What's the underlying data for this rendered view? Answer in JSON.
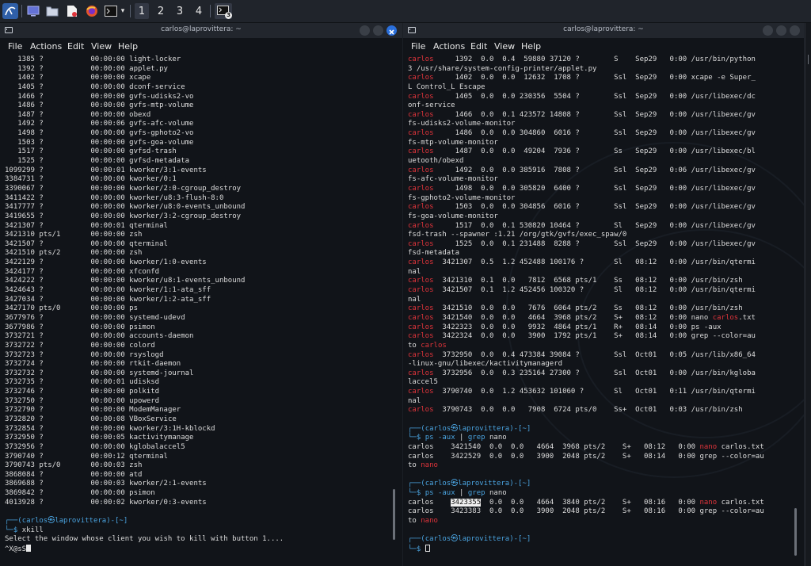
{
  "taskbar": {
    "workspaces": [
      "1",
      "2",
      "3",
      "4"
    ],
    "badge": "3"
  },
  "window_left": {
    "title": "carlos@laprovittera: ~",
    "menu": [
      "File",
      "Actions",
      "Edit",
      "View",
      "Help"
    ],
    "rows": [
      [
        "1385",
        "?",
        "00:00:00",
        "light-locker"
      ],
      [
        "1392",
        "?",
        "00:00:00",
        "applet.py"
      ],
      [
        "1402",
        "?",
        "00:00:00",
        "xcape"
      ],
      [
        "1405",
        "?",
        "00:00:00",
        "dconf-service"
      ],
      [
        "1466",
        "?",
        "00:00:00",
        "gvfs-udisks2-vo"
      ],
      [
        "1486",
        "?",
        "00:00:00",
        "gvfs-mtp-volume"
      ],
      [
        "1487",
        "?",
        "00:00:00",
        "obexd"
      ],
      [
        "1492",
        "?",
        "00:00:06",
        "gvfs-afc-volume"
      ],
      [
        "1498",
        "?",
        "00:00:00",
        "gvfs-gphoto2-vo"
      ],
      [
        "1503",
        "?",
        "00:00:00",
        "gvfs-goa-volume"
      ],
      [
        "1517",
        "?",
        "00:00:00",
        "gvfsd-trash"
      ],
      [
        "1525",
        "?",
        "00:00:00",
        "gvfsd-metadata"
      ],
      [
        "1099299",
        "?",
        "00:00:01",
        "kworker/3:1-events"
      ],
      [
        "3384731",
        "?",
        "00:00:00",
        "kworker/0:1"
      ],
      [
        "3390067",
        "?",
        "00:00:00",
        "kworker/2:0-cgroup_destroy"
      ],
      [
        "3411422",
        "?",
        "00:00:00",
        "kworker/u8:3-flush-8:0"
      ],
      [
        "3417777",
        "?",
        "00:00:00",
        "kworker/u8:0-events_unbound"
      ],
      [
        "3419655",
        "?",
        "00:00:00",
        "kworker/3:2-cgroup_destroy"
      ],
      [
        "3421307",
        "?",
        "00:00:01",
        "qterminal"
      ],
      [
        "3421310",
        "pts/1",
        "00:00:00",
        "zsh"
      ],
      [
        "3421507",
        "?",
        "00:00:00",
        "qterminal"
      ],
      [
        "3421510",
        "pts/2",
        "00:00:00",
        "zsh"
      ],
      [
        "3422129",
        "?",
        "00:00:00",
        "kworker/1:0-events"
      ],
      [
        "3424177",
        "?",
        "00:00:00",
        "xfconfd"
      ],
      [
        "3424222",
        "?",
        "00:00:00",
        "kworker/u8:1-events_unbound"
      ],
      [
        "3424643",
        "?",
        "00:00:00",
        "kworker/1:1-ata_sff"
      ],
      [
        "3427034",
        "?",
        "00:00:00",
        "kworker/1:2-ata_sff"
      ],
      [
        "3427170",
        "pts/0",
        "00:00:00",
        "ps"
      ],
      [
        "3677976",
        "?",
        "00:00:00",
        "systemd-udevd"
      ],
      [
        "3677986",
        "?",
        "00:00:00",
        "psimon"
      ],
      [
        "3732721",
        "?",
        "00:00:00",
        "accounts-daemon"
      ],
      [
        "3732722",
        "?",
        "00:00:00",
        "colord"
      ],
      [
        "3732723",
        "?",
        "00:00:00",
        "rsyslogd"
      ],
      [
        "3732724",
        "?",
        "00:00:00",
        "rtkit-daemon"
      ],
      [
        "3732732",
        "?",
        "00:00:00",
        "systemd-journal"
      ],
      [
        "3732735",
        "?",
        "00:00:01",
        "udisksd"
      ],
      [
        "3732746",
        "?",
        "00:00:00",
        "polkitd"
      ],
      [
        "3732750",
        "?",
        "00:00:00",
        "upowerd"
      ],
      [
        "3732790",
        "?",
        "00:00:00",
        "ModemManager"
      ],
      [
        "3732820",
        "?",
        "00:00:08",
        "VBoxService"
      ],
      [
        "3732854",
        "?",
        "00:00:00",
        "kworker/3:1H-kblockd"
      ],
      [
        "3732950",
        "?",
        "00:00:05",
        "kactivitymanage"
      ],
      [
        "3732956",
        "?",
        "00:00:00",
        "kglobalaccel5"
      ],
      [
        "3790740",
        "?",
        "00:00:12",
        "qterminal"
      ],
      [
        "3790743",
        "pts/0",
        "00:00:03",
        "zsh"
      ],
      [
        "3868084",
        "?",
        "00:00:00",
        "atd"
      ],
      [
        "3869688",
        "?",
        "00:00:03",
        "kworker/2:1-events"
      ],
      [
        "3869842",
        "?",
        "00:00:00",
        "psimon"
      ],
      [
        "4013928",
        "?",
        "00:00:02",
        "kworker/0:3-events"
      ]
    ],
    "prompt_top": "┌──(",
    "prompt_user": "carlos㉿laprovittera",
    "prompt_path": ")-[~]",
    "prompt_bottom": "└─$ ",
    "command": "xkill",
    "output1": "Select the window whose client you wish to kill with button 1....",
    "output2": "^X@sS"
  },
  "window_right": {
    "title": "carlos@laprovittera: ~",
    "menu": [
      "File",
      "Actions",
      "Edit",
      "View",
      "Help"
    ],
    "lines": [
      {
        "user": "carlos",
        "rest": "     1392  0.0  0.4  59880 37120 ?        S    Sep29   0:00 /usr/bin/python"
      },
      {
        "user": "",
        "rest": "3 /usr/share/system-config-printer/applet.py"
      },
      {
        "user": "carlos",
        "rest": "     1402  0.0  0.0  12632  1708 ?        Ssl  Sep29   0:00 xcape -e Super_"
      },
      {
        "user": "",
        "rest": "L Control_L Escape"
      },
      {
        "user": "carlos",
        "rest": "     1405  0.0  0.0 230356  5504 ?        Ssl  Sep29   0:00 /usr/libexec/dc"
      },
      {
        "user": "",
        "rest": "onf-service"
      },
      {
        "user": "carlos",
        "rest": "     1466  0.0  0.1 423572 14808 ?        Ssl  Sep29   0:00 /usr/libexec/gv"
      },
      {
        "user": "",
        "rest": "fs-udisks2-volume-monitor"
      },
      {
        "user": "carlos",
        "rest": "     1486  0.0  0.0 304860  6016 ?        Ssl  Sep29   0:00 /usr/libexec/gv"
      },
      {
        "user": "",
        "rest": "fs-mtp-volume-monitor"
      },
      {
        "user": "carlos",
        "rest": "     1487  0.0  0.0  49204  7936 ?        Ss   Sep29   0:00 /usr/libexec/bl"
      },
      {
        "user": "",
        "rest": "uetooth/obexd"
      },
      {
        "user": "carlos",
        "rest": "     1492  0.0  0.0 385916  7808 ?        Ssl  Sep29   0:06 /usr/libexec/gv"
      },
      {
        "user": "",
        "rest": "fs-afc-volume-monitor"
      },
      {
        "user": "carlos",
        "rest": "     1498  0.0  0.0 305820  6400 ?        Ssl  Sep29   0:00 /usr/libexec/gv"
      },
      {
        "user": "",
        "rest": "fs-gphoto2-volume-monitor"
      },
      {
        "user": "carlos",
        "rest": "     1503  0.0  0.0 304856  6016 ?        Ssl  Sep29   0:00 /usr/libexec/gv"
      },
      {
        "user": "",
        "rest": "fs-goa-volume-monitor"
      },
      {
        "user": "carlos",
        "rest": "     1517  0.0  0.1 530820 10464 ?        Sl   Sep29   0:00 /usr/libexec/gv"
      },
      {
        "user": "",
        "rest": "fsd-trash --spawner :1.21 /org/gtk/gvfs/exec_spaw/0"
      },
      {
        "user": "carlos",
        "rest": "     1525  0.0  0.1 231488  8288 ?        Ssl  Sep29   0:00 /usr/libexec/gv"
      },
      {
        "user": "",
        "rest": "fsd-metadata"
      },
      {
        "user": "carlos",
        "rest": "  3421307  0.5  1.2 452488 100176 ?       Sl   08:12   0:00 /usr/bin/qtermi"
      },
      {
        "user": "",
        "rest": "nal"
      },
      {
        "user": "carlos",
        "rest": "  3421310  0.1  0.0   7812  6568 pts/1    Ss   08:12   0:00 /usr/bin/zsh"
      },
      {
        "user": "carlos",
        "rest": "  3421507  0.1  1.2 452456 100320 ?       Sl   08:12   0:00 /usr/bin/qtermi"
      },
      {
        "user": "",
        "rest": "nal"
      },
      {
        "user": "carlos",
        "rest": "  3421510  0.0  0.0   7676  6064 pts/2    Ss   08:12   0:00 /usr/bin/zsh"
      },
      {
        "user": "carlos",
        "rest": "  3421540  0.0  0.0   4664  3968 pts/2    S+   08:12   0:00 nano ",
        "hit": "carlos",
        "tail": ".txt"
      },
      {
        "user": "carlos",
        "rest": "  3422323  0.0  0.0   9932  4864 pts/1    R+   08:14   0:00 ps -aux"
      },
      {
        "user": "carlos",
        "rest": "  3422324  0.0  0.0   3900  1792 pts/1    S+   08:14   0:00 grep --color=au"
      },
      {
        "user": "",
        "rest": "to ",
        "hit": "carlos",
        "tail": ""
      },
      {
        "user": "carlos",
        "rest": "  3732950  0.0  0.4 473384 39084 ?        Ssl  Oct01   0:05 /usr/lib/x86_64"
      },
      {
        "user": "",
        "rest": "-linux-gnu/libexec/kactivitymanagerd"
      },
      {
        "user": "carlos",
        "rest": "  3732956  0.0  0.3 235164 27300 ?        Ssl  Oct01   0:00 /usr/bin/kgloba"
      },
      {
        "user": "",
        "rest": "laccel5"
      },
      {
        "user": "carlos",
        "rest": "  3790740  0.0  1.2 453632 101060 ?       Sl   Oct01   0:11 /usr/bin/qtermi"
      },
      {
        "user": "",
        "rest": "nal"
      },
      {
        "user": "carlos",
        "rest": "  3790743  0.0  0.0   7908  6724 pts/0    Ss+  Oct01   0:03 /usr/bin/zsh"
      }
    ],
    "prompt_top": "┌──(",
    "prompt_user": "carlos㉿laprovittera",
    "prompt_path": ")-[~]",
    "prompt_bottom": "└─$ ",
    "cmd1": "ps",
    "cmd1_args": " -aux ",
    "cmd1_pipe": "|",
    "cmd1_grep": " grep",
    "cmd1_term": " nano",
    "res1": [
      {
        "a": "carlos    3421540  0.0  0.0   4664  3968 pts/2    S+   08:12   0:00 ",
        "hit": "nano",
        "b": " carlos.txt"
      },
      {
        "a": "carlos    3422529  0.0  0.0   3900  2048 pts/2    S+   08:14   0:00 grep --color=au",
        "hit": "",
        "b": ""
      },
      {
        "a": "to ",
        "hit": "nano",
        "b": ""
      }
    ],
    "res2": [
      {
        "user": "carlos",
        "pid": "3423355",
        "a": "  0.0  0.0   4664  3840 pts/2    S+   08:16   0:00 ",
        "hit": "nano",
        "b": " carlos.txt"
      },
      {
        "user": "carlos",
        "pid": "3423383",
        "a": "  0.0  0.0   3900  2048 pts/2    S+   08:16   0:00 grep --color=au",
        "hit": "",
        "b": ""
      }
    ],
    "res2_tail": "to ",
    "res2_tail_hit": "nano"
  }
}
